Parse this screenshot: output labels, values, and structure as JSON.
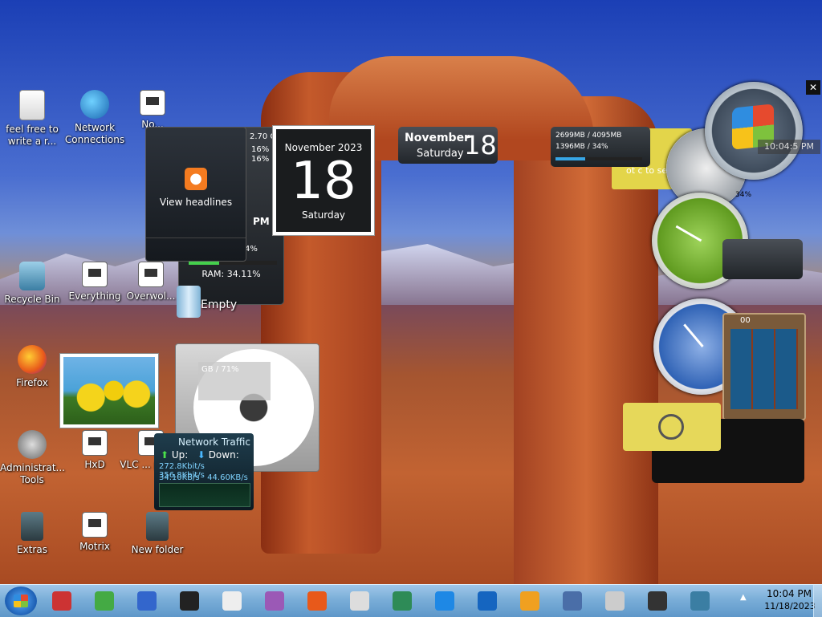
{
  "desktop_icons": [
    {
      "label": "feel free to write a r...",
      "icon": "text-document-icon"
    },
    {
      "label": "Network Connections",
      "icon": "network-icon"
    },
    {
      "label": "No...",
      "icon": "notepad-icon"
    },
    {
      "label": "Recycle Bin",
      "icon": "recycle-bin-icon"
    },
    {
      "label": "Everything",
      "icon": "everything-search-icon"
    },
    {
      "label": "Overwol...",
      "icon": "app-icon"
    },
    {
      "label": "Firefox",
      "icon": "firefox-icon"
    },
    {
      "label": "Administrat... Tools",
      "icon": "tools-icon"
    },
    {
      "label": "HxD",
      "icon": "hex-editor-icon"
    },
    {
      "label": "VLC ... play...",
      "icon": "vlc-icon"
    },
    {
      "label": "Extras",
      "icon": "folder-icon"
    },
    {
      "label": "Motrix",
      "icon": "motrix-icon"
    },
    {
      "label": "New folder",
      "icon": "folder-icon"
    }
  ],
  "gadgets": {
    "rss": {
      "label": "View headlines"
    },
    "cpu": {
      "ghz": "2.70 GH",
      "pct1": "16%",
      "pct2": "16%",
      "pm": "PM",
      "pct3": "4%",
      "ram": "RAM: 34.11%",
      "ram_fraction": 0.3411
    },
    "calendar": {
      "month_year": "November 2023",
      "day": "18",
      "weekday": "Saturday"
    },
    "date": {
      "month": "November",
      "weekday": "Saturday",
      "day": "18"
    },
    "memory": {
      "line1": "2699MB / 4095MB",
      "line2": "1396MB / 34%",
      "fraction": 0.34
    },
    "note_text": "ot c\nto servic",
    "clock_time": "10:04:5 PM",
    "battery_pct": "34%",
    "trash_label": "Empty",
    "drive": {
      "info": "GB / 71%"
    },
    "network": {
      "title": "Network Traffic",
      "up_label": "Up:",
      "down_label": "Down:",
      "up_rate_bits": "272.8Kbit/s",
      "down_rate_bits": "356.8Kbit/s",
      "up_rate_bytes": "34.10KB/s",
      "down_rate_bytes": "44.60KB/s"
    },
    "puzzle_number": "00"
  },
  "taskbar": {
    "items": [
      "taskbar-store-icon",
      "chrome-icon",
      "tools-icon",
      "ink-icon",
      "cards-icon",
      "media-icon",
      "firefox-icon",
      "dragon-icon",
      "hxd-icon",
      "monitor-icon",
      "network-icon",
      "paint-icon",
      "picture-icon",
      "document-icon",
      "payment-icon",
      "remote-icon"
    ],
    "time": "10:04 PM",
    "date": "11/18/2023"
  }
}
